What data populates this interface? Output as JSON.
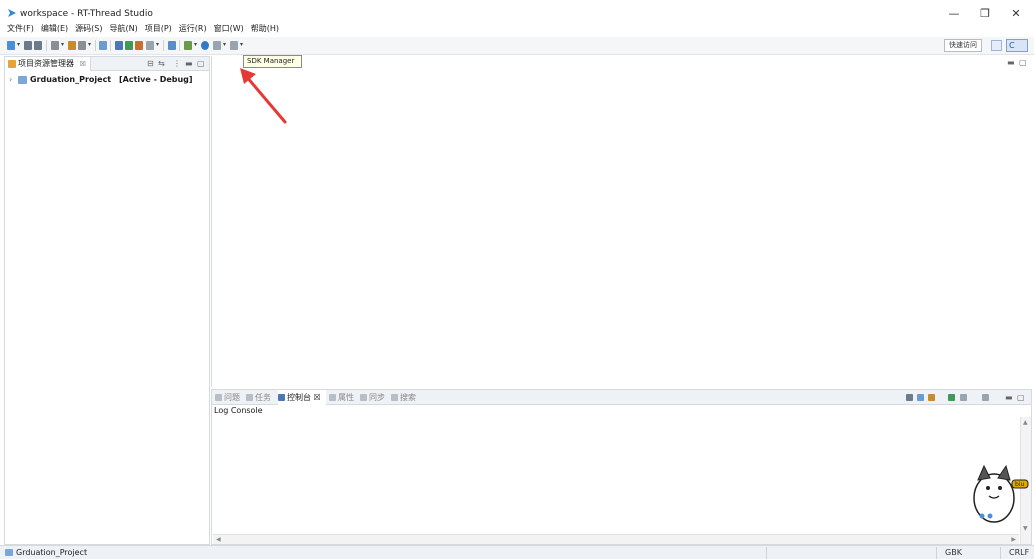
{
  "window": {
    "title": "workspace - RT-Thread Studio",
    "minimize_glyph": "—",
    "restore_glyph": "❐",
    "close_glyph": "✕"
  },
  "menu": {
    "items": [
      "文件(F)",
      "编辑(E)",
      "源码(S)",
      "导航(N)",
      "项目(P)",
      "运行(R)",
      "窗口(W)",
      "帮助(H)"
    ]
  },
  "toolbar": {
    "tooltip": "SDK Manager",
    "quick_access": "快速访问",
    "perspective_label": "C"
  },
  "colors": {
    "accent_blue": "#4a78b5",
    "arrow_red": "#e53935",
    "tooltip_bg": "#ffffe6"
  },
  "project_explorer": {
    "tab_label": "项目资源管理器",
    "tab_close": "☒",
    "project_name": "Grduation_Project",
    "project_status": "[Active - Debug]"
  },
  "bottom_panel": {
    "tabs": [
      {
        "label": "问题",
        "active": false
      },
      {
        "label": "任务",
        "active": false
      },
      {
        "label": "控制台 ☒",
        "active": true
      },
      {
        "label": "属性",
        "active": false
      },
      {
        "label": "同步",
        "active": false
      },
      {
        "label": "搜索",
        "active": false
      }
    ],
    "console_title": "Log Console"
  },
  "sticker": {
    "bubble_text": "biu"
  },
  "statusbar": {
    "selected_item": "Grduation_Project",
    "encoding": "GBK",
    "line_ending": "CRLF"
  }
}
